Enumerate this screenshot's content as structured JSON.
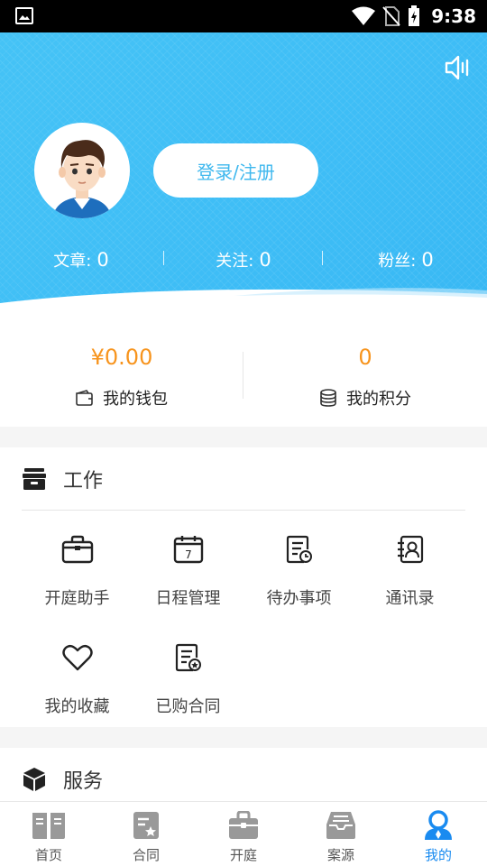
{
  "status_bar": {
    "time": "9:38",
    "icons": [
      "image-icon",
      "wifi-icon",
      "no-sim-icon",
      "battery-charging-icon"
    ]
  },
  "profile": {
    "login_label": "登录/注册",
    "stats": [
      {
        "label": "文章:",
        "value": "0"
      },
      {
        "label": "关注:",
        "value": "0"
      },
      {
        "label": "粉丝:",
        "value": "0"
      }
    ]
  },
  "wallet": {
    "balance": "¥0.00",
    "balance_label": "我的钱包",
    "points": "0",
    "points_label": "我的积分",
    "accent_color": "#f7941d"
  },
  "work": {
    "title": "工作",
    "items": [
      {
        "label": "开庭助手",
        "icon": "briefcase-icon"
      },
      {
        "label": "日程管理",
        "icon": "calendar-icon"
      },
      {
        "label": "待办事项",
        "icon": "todo-icon"
      },
      {
        "label": "通讯录",
        "icon": "contacts-icon"
      },
      {
        "label": "我的收藏",
        "icon": "heart-icon"
      },
      {
        "label": "已购合同",
        "icon": "contract-icon"
      }
    ]
  },
  "service": {
    "title": "服务"
  },
  "tabbar": {
    "active_color": "#1a8bf0",
    "tabs": [
      {
        "label": "首页",
        "icon": "book-icon"
      },
      {
        "label": "合同",
        "icon": "contract-star-icon"
      },
      {
        "label": "开庭",
        "icon": "briefcase-icon"
      },
      {
        "label": "案源",
        "icon": "inbox-icon"
      },
      {
        "label": "我的",
        "icon": "person-icon"
      }
    ],
    "active_tab": "我的"
  },
  "colors": {
    "hero_blue": "#3fbef6"
  }
}
